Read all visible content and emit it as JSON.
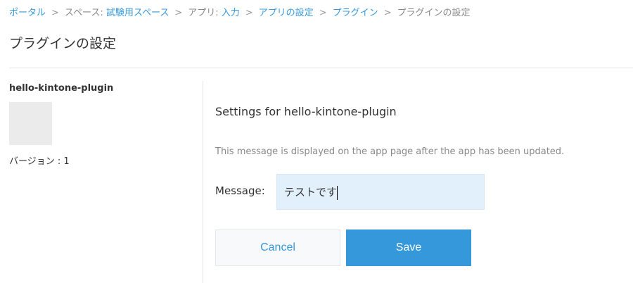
{
  "breadcrumb": {
    "portal": "ポータル",
    "space_prefix": "スペース: ",
    "space": "試験用スペース",
    "app_prefix": "アプリ: ",
    "app": "入力",
    "app_settings": "アプリの設定",
    "plugins": "プラグイン",
    "current": "プラグインの設定",
    "separator": ">"
  },
  "page_title": "プラグインの設定",
  "plugin": {
    "name": "hello-kintone-plugin",
    "version_label": "バージョン : 1"
  },
  "settings": {
    "title": "Settings for hello-kintone-plugin",
    "description": "This message is displayed on the app page after the app has been updated.",
    "message_label": "Message:",
    "message_value": "テストです",
    "cancel_label": "Cancel",
    "save_label": "Save"
  }
}
